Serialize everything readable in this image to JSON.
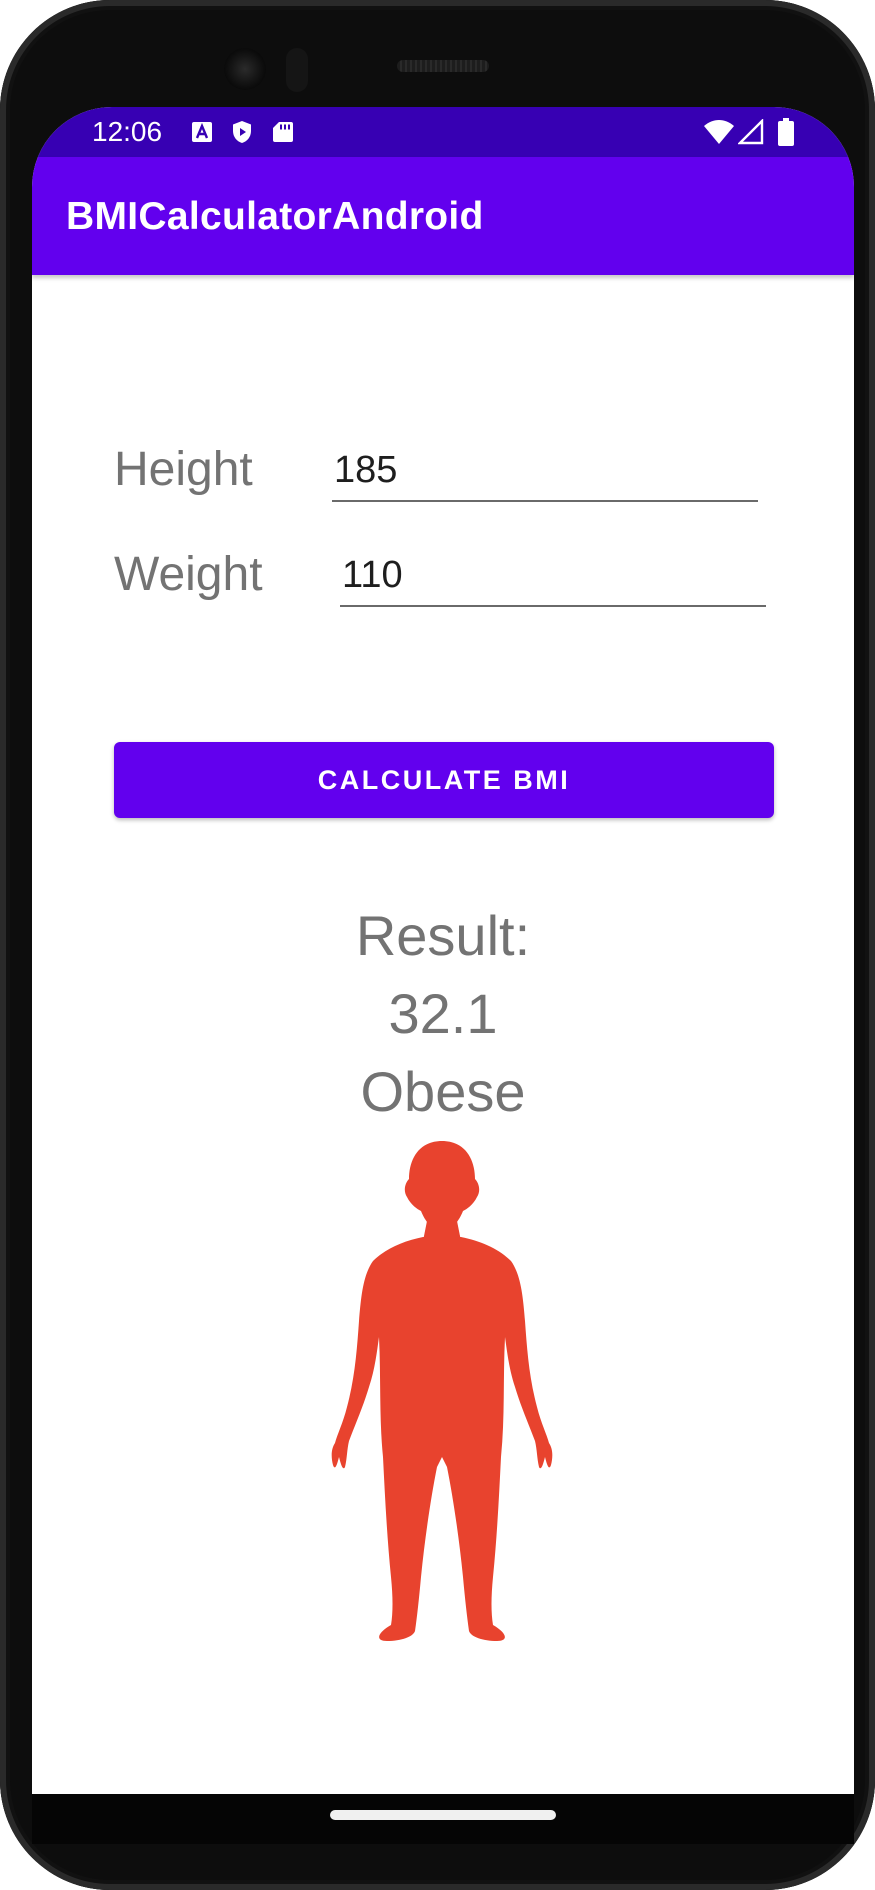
{
  "status_bar": {
    "time": "12:06",
    "icons": [
      "a-notification-icon",
      "play-protect-icon",
      "sd-card-icon",
      "wifi-icon",
      "cellular-signal-icon",
      "battery-icon"
    ]
  },
  "app_bar": {
    "title": "BMICalculatorAndroid"
  },
  "form": {
    "height_label": "Height",
    "height_value": "185",
    "weight_label": "Weight",
    "weight_value": "110"
  },
  "calculate_button": {
    "label": "CALCULATE BMI"
  },
  "result": {
    "heading": "Result:",
    "bmi_value": "32.1",
    "category": "Obese"
  },
  "silhouette": {
    "icon": "obese-body-silhouette-icon",
    "color": "#e8432e"
  },
  "colors": {
    "status_bar": "#3700b3",
    "primary": "#6200ee",
    "label_text": "#737373"
  }
}
